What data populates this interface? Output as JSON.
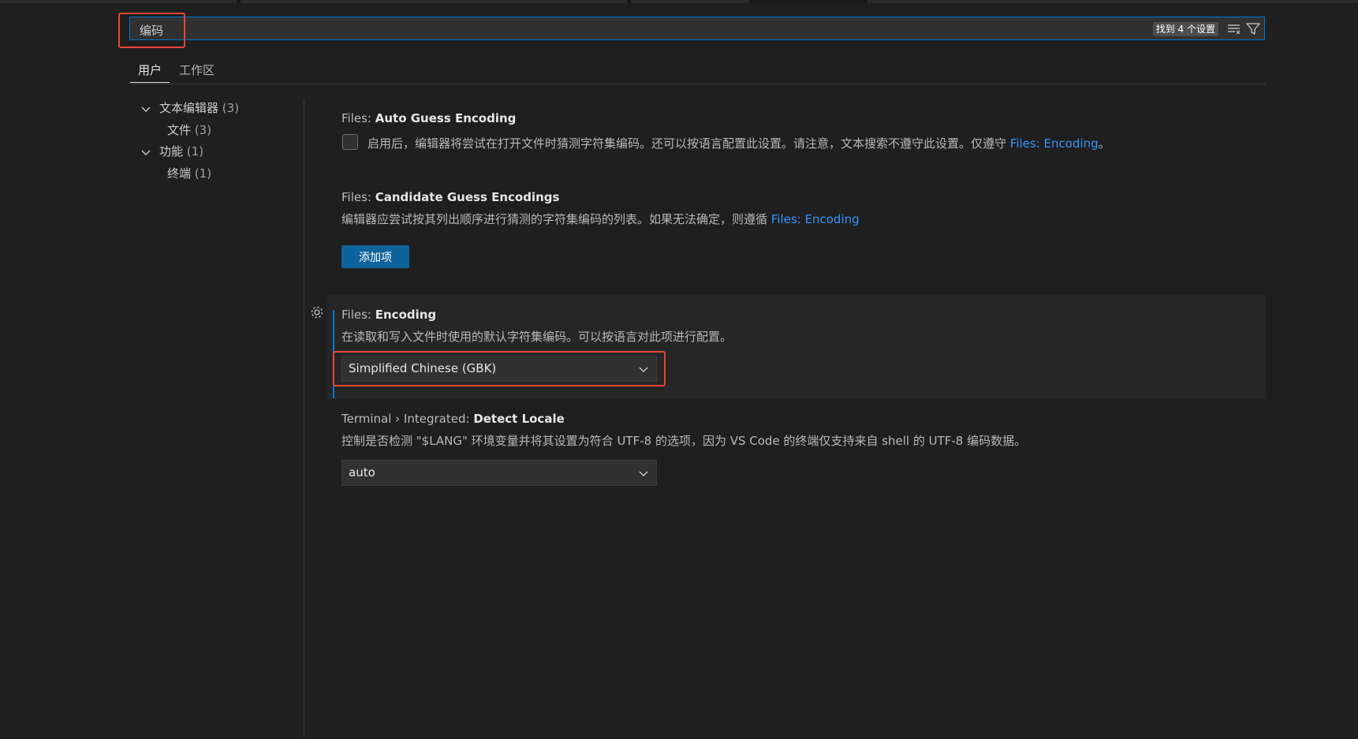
{
  "search": {
    "query": "编码",
    "result_count": "找到 4 个设置",
    "clear_filter_icon": "clear-filter-icon",
    "filter_icon": "filter-icon"
  },
  "tabs": [
    {
      "label": "用户",
      "active": true
    },
    {
      "label": "工作区",
      "active": false
    }
  ],
  "toc": [
    {
      "label": "文本编辑器",
      "count": "(3)",
      "expanded": true
    },
    {
      "label": "文件",
      "count": "(3)"
    },
    {
      "label": "功能",
      "count": "(1)",
      "expanded": true
    },
    {
      "label": "终端",
      "count": "(1)"
    }
  ],
  "settings": [
    {
      "category": "Files: ",
      "key": "Auto Guess Encoding",
      "description": "启用后，编辑器将尝试在打开文件时猜测字符集编码。还可以按语言配置此设置。请注意，文本搜索不遵守此设置。仅遵守 ",
      "link": "Files: Encoding",
      "suffix": "。",
      "checked": false
    },
    {
      "category": "Files: ",
      "key": "Candidate Guess Encodings",
      "description": "编辑器应尝试按其列出顺序进行猜测的字符集编码的列表。如果无法确定，则遵循 ",
      "link": "Files: Encoding",
      "button": "添加项"
    },
    {
      "category": "Files: ",
      "key": "Encoding",
      "description": "在读取和写入文件时使用的默认字符集编码。可以按语言对此项进行配置。",
      "value": "Simplified Chinese (GBK)"
    },
    {
      "category": "Terminal › Integrated: ",
      "key": "Detect Locale",
      "description": "控制是否检测 \"$LANG\" 环境变量并将其设置为符合 UTF-8 的选项，因为 VS Code 的终端仅支持来自 shell 的 UTF-8 编码数据。",
      "value": "auto"
    }
  ],
  "colors": {
    "background": "#1f1f1f",
    "accent": "#0078d4",
    "link": "#3794ff",
    "button": "#0e639c",
    "annotation": "#e8463a"
  }
}
